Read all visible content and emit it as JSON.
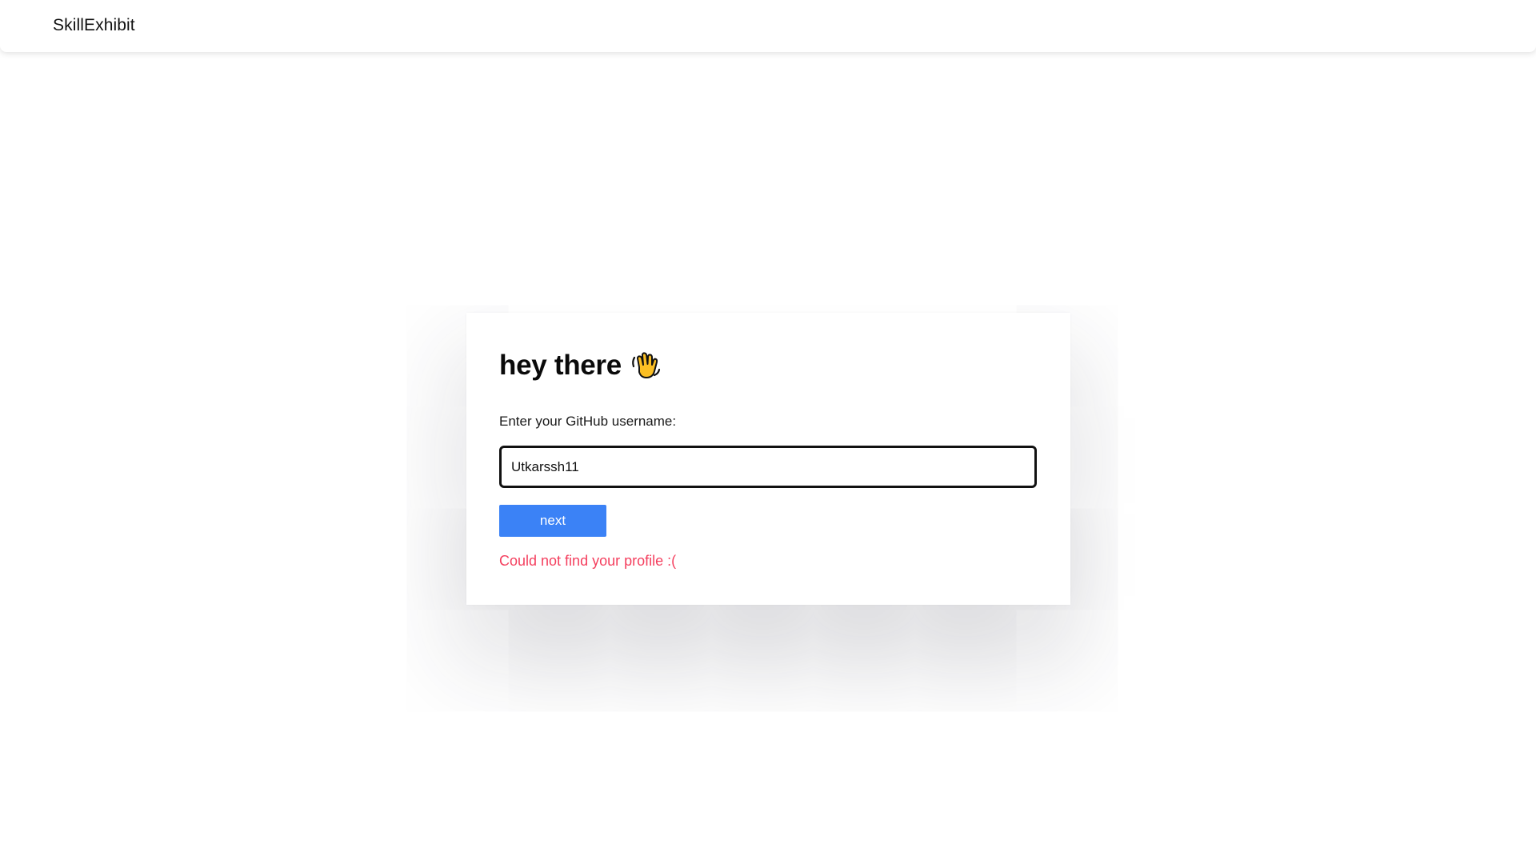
{
  "navbar": {
    "brand": "SkillExhibit"
  },
  "form": {
    "heading": "hey there",
    "heading_icon": "waving-hand-icon",
    "label": "Enter your GitHub username:",
    "username_value": "Utkarssh11",
    "next_label": "next",
    "error_message": "Could not find your profile :("
  },
  "colors": {
    "accent": "#3b82f6",
    "error": "#f43f5e",
    "text": "#111111"
  }
}
